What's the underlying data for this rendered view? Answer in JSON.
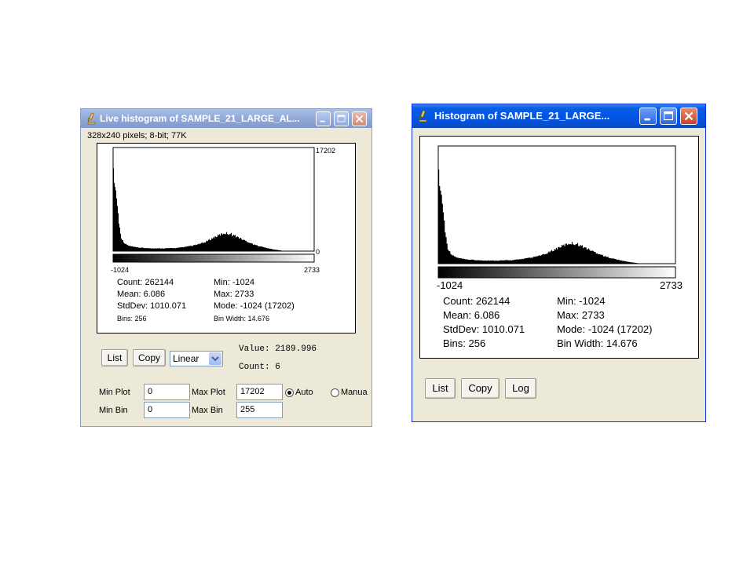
{
  "live_window": {
    "title": "Live histogram of SAMPLE_21_LARGE_AL...",
    "image_info": "328x240 pixels; 8-bit; 77K",
    "plot": {
      "y_max_label": "17202",
      "y_min_label": "0",
      "x_min_label": "-1024",
      "x_max_label": "2733"
    },
    "stats": {
      "count": "Count: 262144",
      "mean": "Mean: 6.086",
      "stddev": "StdDev: 1010.071",
      "bins": "Bins: 256",
      "min": "Min: -1024",
      "max": "Max: 2733",
      "mode": "Mode: -1024 (17202)",
      "bin_width": "Bin Width: 14.676"
    },
    "buttons": {
      "list": "List",
      "copy": "Copy"
    },
    "scale_select": {
      "selected": "Linear"
    },
    "cursor": {
      "value": "Value: 2189.996",
      "count": "Count: 6"
    },
    "range": {
      "min_plot_label": "Min Plot",
      "min_plot_value": "0",
      "max_plot_label": "Max Plot",
      "max_plot_value": "17202",
      "min_bin_label": "Min Bin",
      "min_bin_value": "0",
      "max_bin_label": "Max Bin",
      "max_bin_value": "255",
      "auto_label": "Auto",
      "manual_label": "Manua",
      "auto_selected": true
    }
  },
  "static_window": {
    "title": "Histogram of SAMPLE_21_LARGE...",
    "plot": {
      "x_min_label": "-1024",
      "x_max_label": "2733"
    },
    "stats": {
      "count": "Count: 262144",
      "mean": "Mean: 6.086",
      "stddev": "StdDev: 1010.071",
      "bins": "Bins: 256",
      "min": "Min: -1024",
      "max": "Max: 2733",
      "mode": "Mode: -1024 (17202)",
      "bin_width": "Bin Width: 14.676"
    },
    "buttons": {
      "list": "List",
      "copy": "Copy",
      "log": "Log"
    }
  },
  "chart_data": {
    "type": "bar",
    "x_range": [
      -1024,
      2733
    ],
    "y_range": [
      0,
      17202
    ],
    "bins": 256,
    "profile": [
      [
        0,
        0.8
      ],
      [
        1,
        0.66
      ],
      [
        2,
        0.62
      ],
      [
        3,
        0.58
      ],
      [
        4,
        0.52
      ],
      [
        5,
        0.44
      ],
      [
        6,
        0.36
      ],
      [
        7,
        0.28
      ],
      [
        8,
        0.22
      ],
      [
        9,
        0.17
      ],
      [
        10,
        0.13
      ],
      [
        12,
        0.1
      ],
      [
        15,
        0.07
      ],
      [
        20,
        0.05
      ],
      [
        30,
        0.035
      ],
      [
        45,
        0.028
      ],
      [
        60,
        0.026
      ],
      [
        80,
        0.03
      ],
      [
        100,
        0.05
      ],
      [
        115,
        0.08
      ],
      [
        130,
        0.14
      ],
      [
        142,
        0.175
      ],
      [
        150,
        0.165
      ],
      [
        165,
        0.11
      ],
      [
        180,
        0.06
      ],
      [
        195,
        0.03
      ],
      [
        205,
        0.015
      ],
      [
        215,
        0.004
      ],
      [
        225,
        0.0
      ],
      [
        255,
        0.0
      ]
    ]
  },
  "colors": {
    "live_title_bg": "#8ea6d6",
    "xp_title_bg": "#0054e3",
    "window_bg": "#ece9d8",
    "close_btn": "#c9412a"
  }
}
